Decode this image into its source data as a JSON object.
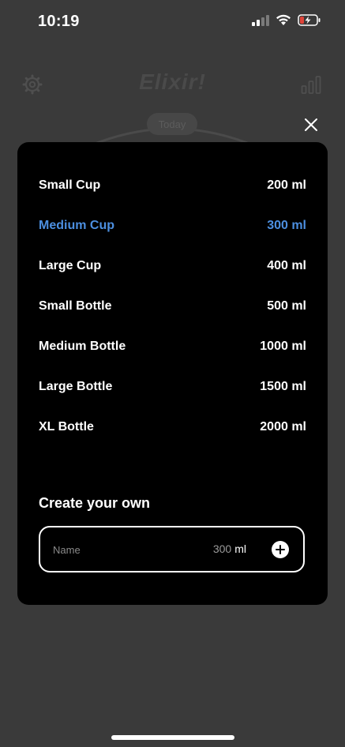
{
  "status_bar": {
    "time": "10:19"
  },
  "background": {
    "app_title": "Elixir!",
    "today_label": "Today"
  },
  "presets": [
    {
      "name": "Small Cup",
      "amount": "200 ml",
      "selected": false
    },
    {
      "name": "Medium Cup",
      "amount": "300 ml",
      "selected": true
    },
    {
      "name": "Large Cup",
      "amount": "400 ml",
      "selected": false
    },
    {
      "name": "Small Bottle",
      "amount": "500 ml",
      "selected": false
    },
    {
      "name": "Medium Bottle",
      "amount": "1000 ml",
      "selected": false
    },
    {
      "name": "Large Bottle",
      "amount": "1500 ml",
      "selected": false
    },
    {
      "name": "XL Bottle",
      "amount": "2000 ml",
      "selected": false
    }
  ],
  "create": {
    "title": "Create your own",
    "name_placeholder": "Name",
    "amount_value": "300",
    "unit": "ml"
  },
  "colors": {
    "accent": "#4c8fe0",
    "sheet_background": "#000000",
    "screen_background": "#3a3a3a"
  },
  "icons": {
    "close": "close-icon",
    "add": "plus-circle-icon",
    "settings": "gear-icon",
    "stats": "bar-chart-icon"
  }
}
